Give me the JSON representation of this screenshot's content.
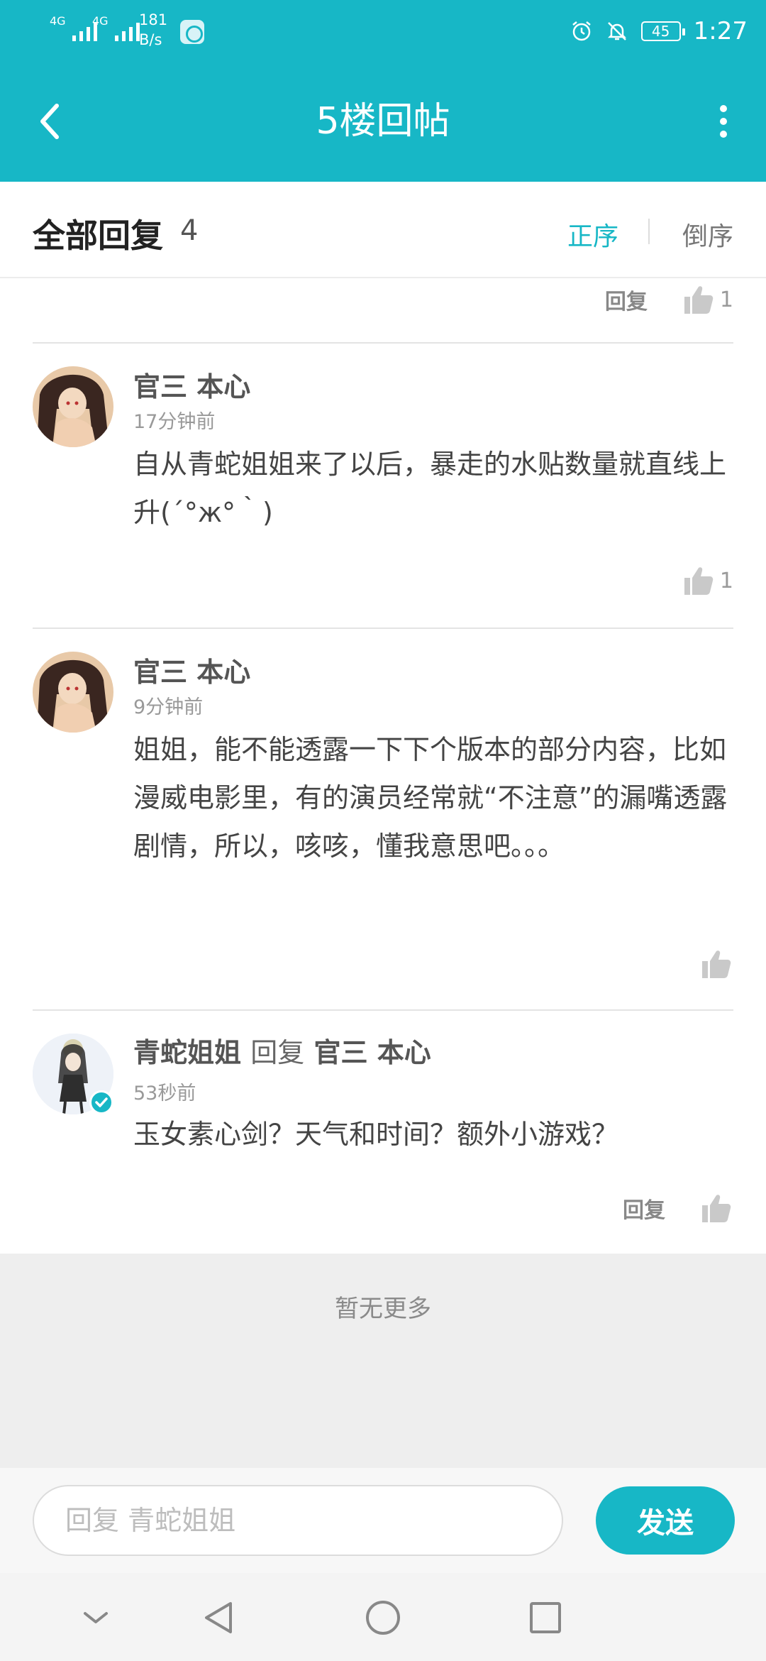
{
  "status_bar": {
    "signal1_label": "4G",
    "signal2_label": "4G",
    "net_speed_value": "181",
    "net_speed_unit": "B/s",
    "battery": "45",
    "time": "1:27"
  },
  "header": {
    "title": "5楼回帖"
  },
  "replies_header": {
    "title": "全部回复",
    "count": "4",
    "sort_asc": "正序",
    "sort_desc": "倒序"
  },
  "prev_comment": {
    "reply_label": "回复",
    "like_count": "1"
  },
  "comments": [
    {
      "author": "官三 本心",
      "time": "17分钟前",
      "content": "自从青蛇姐姐来了以后，暴走的水贴数量就直线上升(´°ж°｀)",
      "like_count": "1"
    },
    {
      "author": "官三 本心",
      "time": "9分钟前",
      "content": "姐姐，能不能透露一下下个版本的部分内容，比如漫威电影里，有的演员经常就“不注意”的漏嘴透露剧情，所以，咳咳，懂我意思吧。。。"
    },
    {
      "author": "青蛇姐姐",
      "reply_word": "回复",
      "reply_to": "官三 本心",
      "time": "53秒前",
      "content": "玉女素心剑？天气和时间？额外小游戏？",
      "reply_label": "回复"
    }
  ],
  "no_more": "暂无更多",
  "input": {
    "placeholder": "回复 青蛇姐姐",
    "send_label": "发送"
  },
  "colors": {
    "accent": "#17b7c6",
    "background": "#ffffff",
    "footer_bg": "#eeeeee"
  }
}
